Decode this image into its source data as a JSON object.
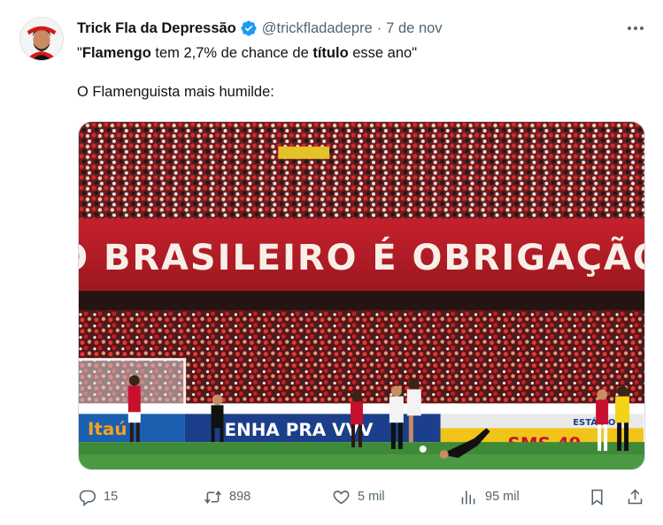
{
  "author": {
    "display_name": "Trick Fla da Depressão",
    "handle": "@trickfladadepre",
    "separator": "·",
    "date": "7 de nov"
  },
  "tweet": {
    "line1_open_quote": "\"",
    "line1_bold1": "Flamengo",
    "line1_mid": " tem 2,7% de chance de ",
    "line1_bold2": "título",
    "line1_end": " esse ano\"",
    "line2": "O Flamenguista mais humilde:"
  },
  "media": {
    "banner_text": "O BRASILEIRO É OBRIGAÇÃO",
    "ad_left": "Itaú",
    "ad_middle": "ENHA PRA VVV",
    "ad_right": "SMS 49",
    "ad_side": "ESTÁDIO"
  },
  "actions": {
    "reply": {
      "icon": "reply-icon",
      "count": "15"
    },
    "retweet": {
      "icon": "retweet-icon",
      "count": "898"
    },
    "like": {
      "icon": "heart-icon",
      "count": "5 mil"
    },
    "views": {
      "icon": "views-icon",
      "count": "95 mil"
    },
    "bookmark": {
      "icon": "bookmark-icon"
    },
    "share": {
      "icon": "share-icon"
    }
  },
  "colors": {
    "text": "#0f1419",
    "secondary": "#536471",
    "verified": "#1d9bf0",
    "flamengo_red": "#c8102e"
  }
}
